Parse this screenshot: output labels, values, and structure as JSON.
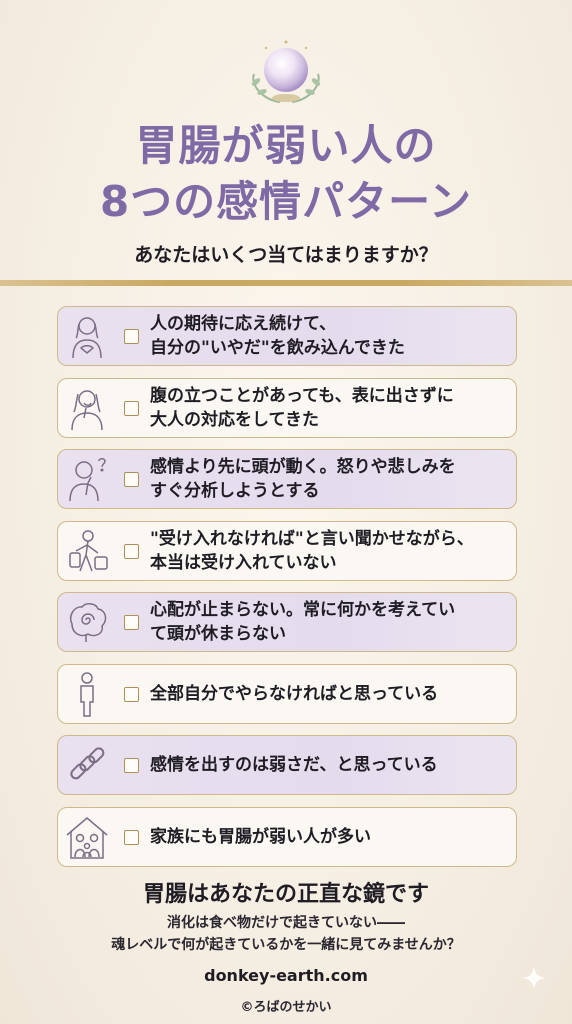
{
  "title": {
    "line1": "胃腸が弱い人の",
    "line2": "8つの感情パターン"
  },
  "subtitle": "あなたはいくつ当てはまりますか？",
  "items": [
    {
      "text": "人の期待に応え続けて、\n自分の\"いやだ\"を飲み込んできた",
      "icon": "woman-hands-on-chest-icon"
    },
    {
      "text": "腹の立つことがあっても、表に出さずに\n大人の対応をしてきた",
      "icon": "woman-covering-mouth-icon"
    },
    {
      "text": "感情より先に頭が動く。怒りや悲しみを\nすぐ分析しようとする",
      "icon": "thinking-person-icon"
    },
    {
      "text": "\"受け入れなければ\"と言い聞かせながら、\n本当は受け入れていない",
      "icon": "person-carrying-luggage-icon"
    },
    {
      "text": "心配が止まらない。常に何かを考えてい\nて頭が休まらない",
      "icon": "brain-spiral-icon"
    },
    {
      "text": "全部自分でやらなければと思っている",
      "icon": "standing-person-icon"
    },
    {
      "text": "感情を出すのは弱さだ、と思っている",
      "icon": "chain-icon"
    },
    {
      "text": "家族にも胃腸が弱い人が多い",
      "icon": "family-house-icon"
    }
  ],
  "footer": {
    "title": "胃腸はあなたの正直な鏡です",
    "line1": "消化は食べ物だけで起きていない――",
    "line2": "魂レベルで何が起きているかを一緒に見てみませんか？",
    "site": "donkey-earth.com",
    "copyright": "©ろばのせかい"
  },
  "colors": {
    "title": "#7f6aa6",
    "gold": "#c9a861",
    "background": "#f7f1e6",
    "card_shaded": "#e6def0"
  }
}
